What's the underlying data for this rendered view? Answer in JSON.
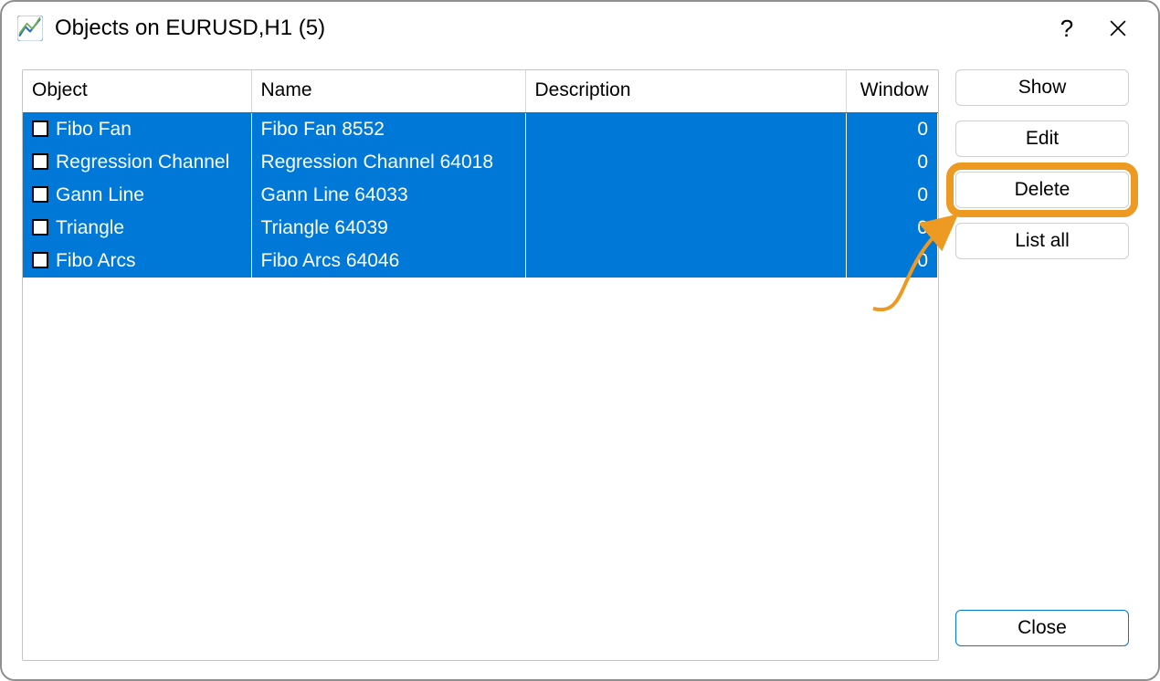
{
  "window": {
    "title": "Objects on EURUSD,H1 (5)"
  },
  "table": {
    "columns": {
      "object": "Object",
      "name": "Name",
      "description": "Description",
      "window": "Window"
    },
    "rows": [
      {
        "object": "Fibo Fan",
        "name": "Fibo Fan 8552",
        "description": "",
        "window": "0"
      },
      {
        "object": "Regression Channel",
        "name": "Regression Channel 64018",
        "description": "",
        "window": "0"
      },
      {
        "object": "Gann Line",
        "name": "Gann Line 64033",
        "description": "",
        "window": "0"
      },
      {
        "object": "Triangle",
        "name": "Triangle 64039",
        "description": "",
        "window": "0"
      },
      {
        "object": "Fibo Arcs",
        "name": "Fibo Arcs 64046",
        "description": "",
        "window": "0"
      }
    ]
  },
  "buttons": {
    "show": "Show",
    "edit": "Edit",
    "delete": "Delete",
    "listAll": "List all",
    "close": "Close"
  },
  "annotation": {
    "highlight_color": "#ED9A22"
  }
}
